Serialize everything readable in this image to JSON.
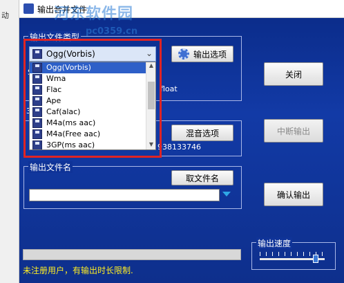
{
  "background_window": {
    "partial_label": "动"
  },
  "window": {
    "title": "输出合并文件",
    "watermark": "河东软件园",
    "watermark_url": "pc0359.cn"
  },
  "output_type": {
    "group_label": "输出文件类型",
    "selected": "Ogg(Vorbis)",
    "options_button": "输出选项",
    "dropdown_items": [
      "Ogg(Vorbis)",
      "Wma",
      "Flac",
      "Ape",
      "Caf(alac)",
      "M4a(ms aac)",
      "M4a(Free aac)",
      "3GP(ms aac)"
    ],
    "partial_text": "float",
    "partial_prefix": "S"
  },
  "mix": {
    "button": "混音选项",
    "partial_value": "938133746",
    "partial_prefix": "3"
  },
  "filename": {
    "group_label": "输出文件名",
    "button": "取文件名",
    "value": ""
  },
  "right_buttons": {
    "close": "关闭",
    "stop": "中断输出",
    "confirm": "确认输出"
  },
  "progress": {
    "value": 0
  },
  "notice": "未注册用户，有输出时长限制.",
  "speed": {
    "label": "输出速度",
    "level": 0.9
  },
  "colors": {
    "window_bg": "#0f3398",
    "highlight_box": "#e02424",
    "notice_text": "#ffee22",
    "selected_item": "#2d5fc8",
    "filename_arrow": "#2fa7e6"
  },
  "icons": {
    "format": "floppy-disk-icon",
    "options": "gear-icon",
    "filename_dropdown": "triangle-down-icon"
  }
}
